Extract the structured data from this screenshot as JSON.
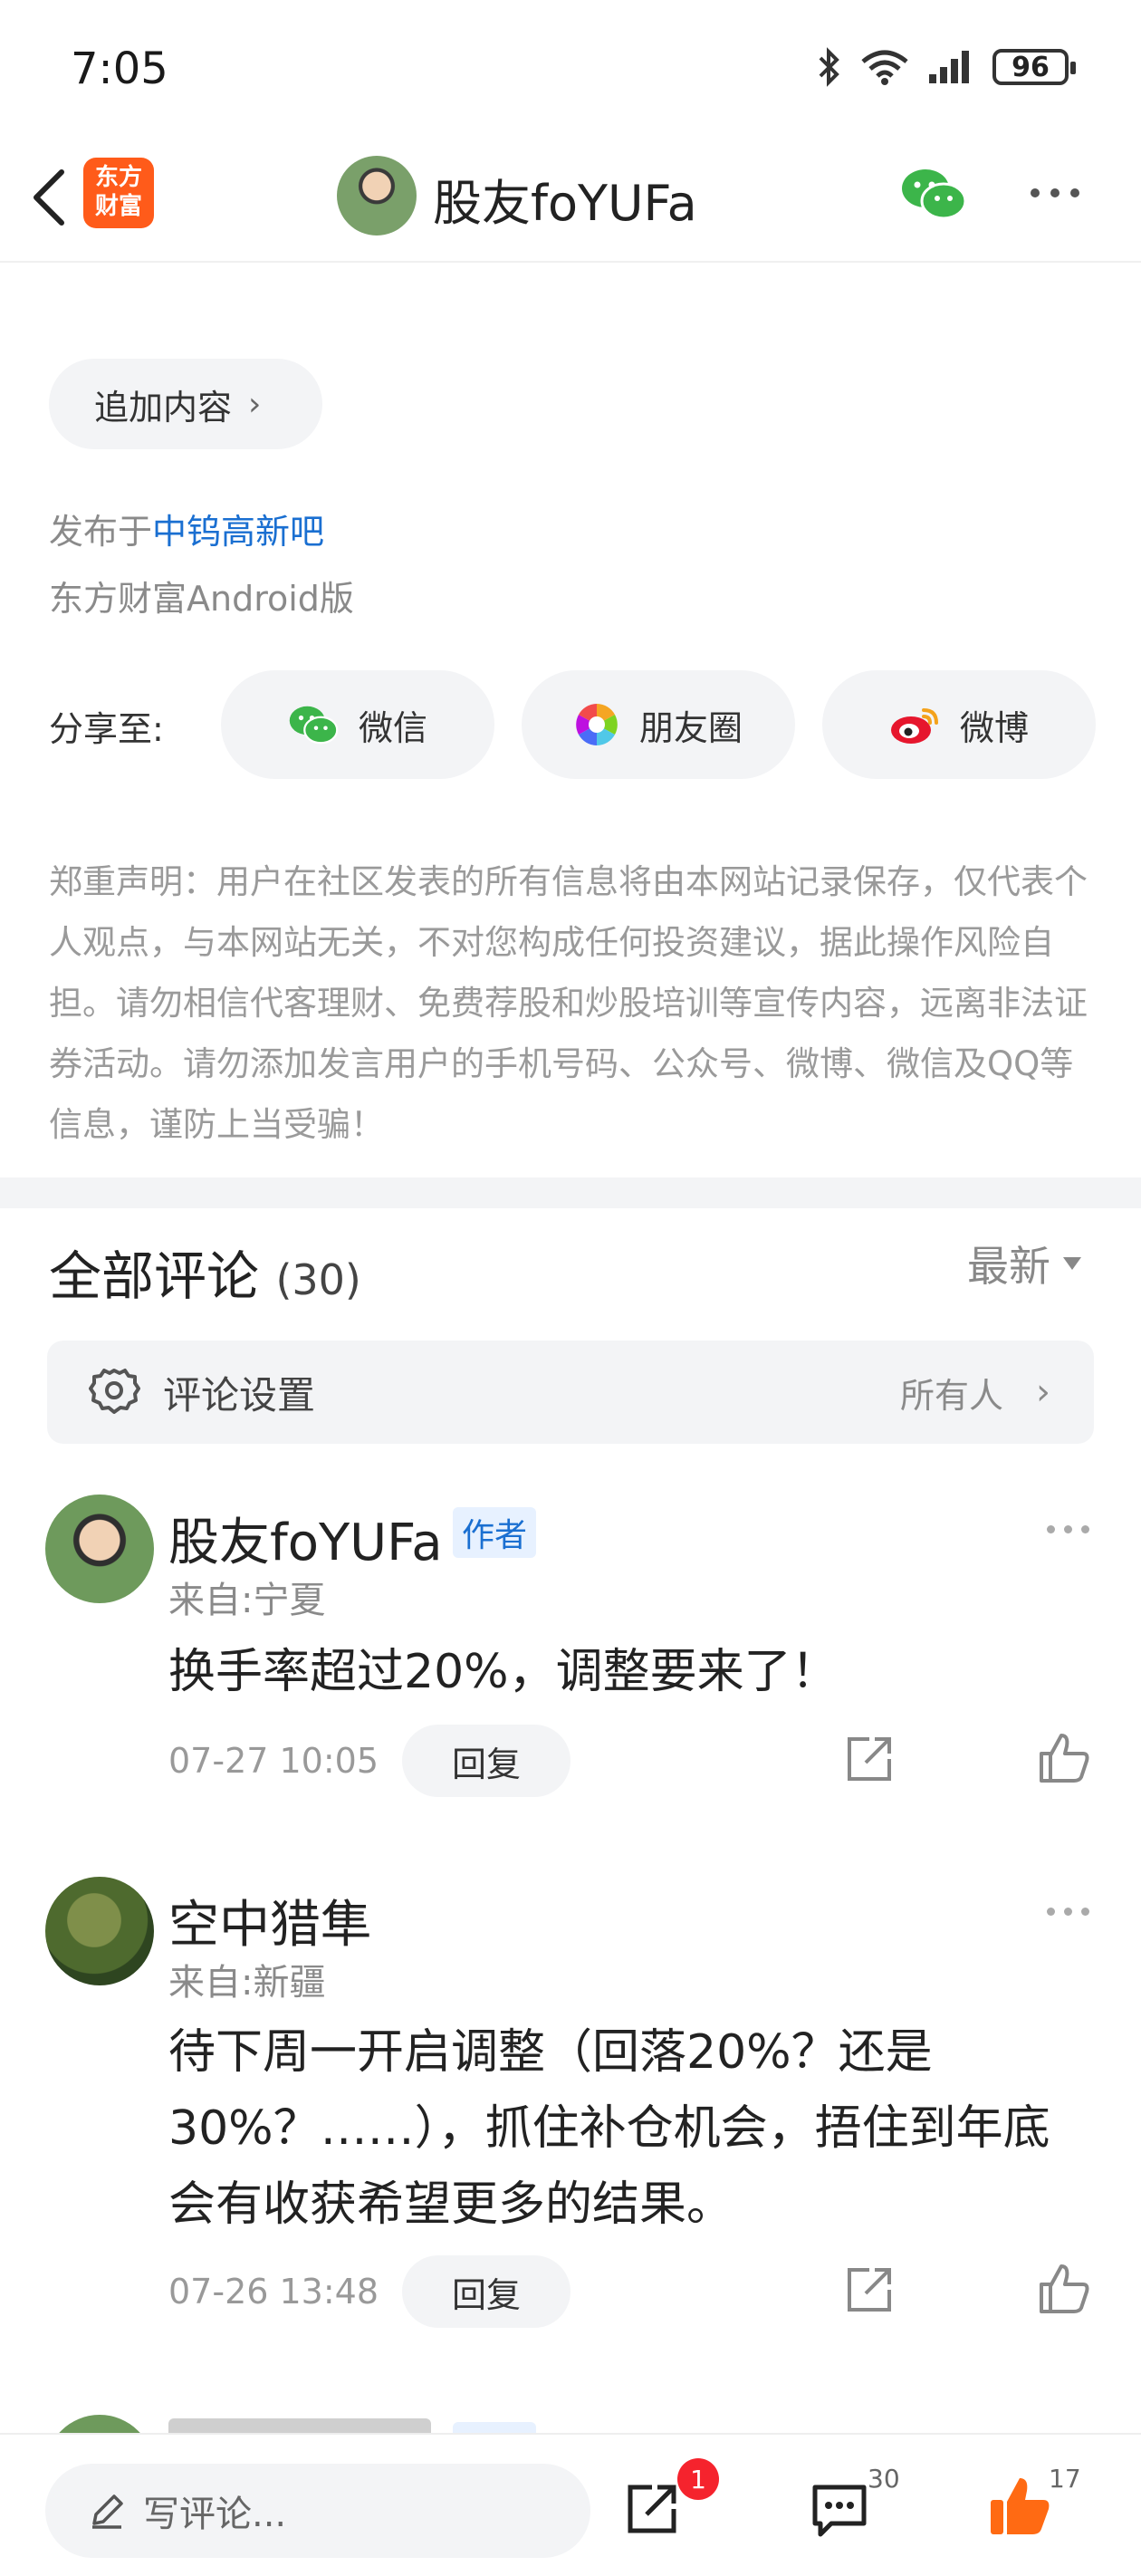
{
  "status_bar": {
    "time": "7:05",
    "battery": "96"
  },
  "nav": {
    "logo_line1": "东方",
    "logo_line2": "财富",
    "title": "股友foYUFa"
  },
  "post": {
    "append_label": "追加内容",
    "published_prefix": "发布于",
    "bar_name": "中钨高新吧",
    "platform": "东方财富Android版"
  },
  "share": {
    "label": "分享至:",
    "wechat": "微信",
    "moments": "朋友圈",
    "weibo": "微博"
  },
  "disclaimer": "郑重声明：用户在社区发表的所有信息将由本网站记录保存，仅代表个人观点，与本网站无关，不对您构成任何投资建议，据此操作风险自担。请勿相信代客理财、免费荐股和炒股培训等宣传内容，远离非法证券活动。请勿添加发言用户的手机号码、公众号、微博、微信及QQ等信息，谨防上当受骗！",
  "comments": {
    "title": "全部评论",
    "count": "(30)",
    "sort": "最新",
    "settings_label": "评论设置",
    "settings_scope": "所有人",
    "items": [
      {
        "name": "股友foYUFa",
        "badge": "作者",
        "location": "来自:宁夏",
        "text": "换手率超过20%，调整要来了！",
        "time": "07-27 10:05",
        "reply": "回复"
      },
      {
        "name": "空中猎隼",
        "location": "来自:新疆",
        "text": "待下周一开启调整（回落20%？还是30%？……），抓住补仓机会，捂住到年底会有收获希望更多的结果。",
        "time": "07-26 13:48",
        "reply": "回复"
      }
    ]
  },
  "bottom_bar": {
    "write_placeholder": "写评论...",
    "share_badge": "1",
    "comment_count": "30",
    "like_count": "17"
  }
}
